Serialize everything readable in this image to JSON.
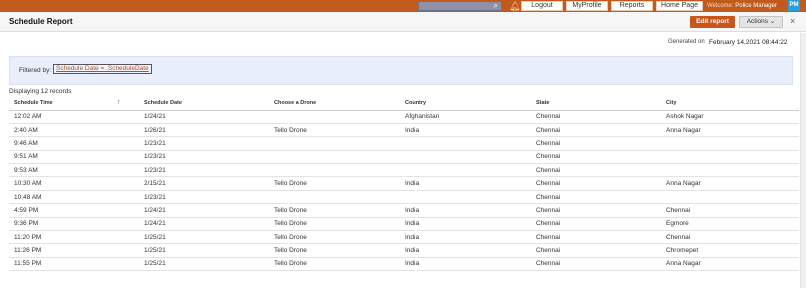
{
  "topbar": {
    "search_placeholder": "",
    "nav": [
      "Logout",
      "MyProfile",
      "Reports",
      "Home Page"
    ],
    "welcome_label": "Welcome:",
    "user_name": "Police Manager",
    "avatar_initials": "PM",
    "accent_color": "#c15a1b"
  },
  "header": {
    "title": "Schedule Report",
    "edit_label": "Edit report",
    "actions_label": "Actions",
    "close_symbol": "×"
  },
  "report": {
    "generated_label": "Generated on",
    "generated_value": "February 14,2021 08:44:22",
    "filter_label": "Filtered by:",
    "filter_value": "Schedule Date = .ScheduleDate",
    "displaying": "Displaying 12 records"
  },
  "table": {
    "columns": [
      "Schedule Time",
      "Schedule Date",
      "Choose a Drone",
      "Country",
      "State",
      "City"
    ],
    "rows": [
      [
        "12:02 AM",
        "1/24/21",
        "",
        "Afghanistan",
        "Chennai",
        "Ashok Nagar"
      ],
      [
        "2:40 AM",
        "1/26/21",
        "Tello Drone",
        "India",
        "Chennai",
        "Anna Nagar"
      ],
      [
        "9:46 AM",
        "1/23/21",
        "",
        "",
        "Chennai",
        ""
      ],
      [
        "9:51 AM",
        "1/23/21",
        "",
        "",
        "Chennai",
        ""
      ],
      [
        "9:53 AM",
        "1/23/21",
        "",
        "",
        "Chennai",
        ""
      ],
      [
        "10:30 AM",
        "2/15/21",
        "Tello Drone",
        "India",
        "Chennai",
        "Anna Nagar"
      ],
      [
        "10:48 AM",
        "1/23/21",
        "",
        "",
        "Chennai",
        ""
      ],
      [
        "4:59 PM",
        "1/24/21",
        "Tello Drone",
        "India",
        "Chennai",
        "Chennai"
      ],
      [
        "9:36 PM",
        "1/24/21",
        "Tello Drone",
        "India",
        "Chennai",
        "Egmore"
      ],
      [
        "11:20 PM",
        "1/25/21",
        "Tello Drone",
        "India",
        "Chennai",
        "Chennai"
      ],
      [
        "11:26 PM",
        "1/25/21",
        "Tello Drone",
        "India",
        "Chennai",
        "Chromepet"
      ],
      [
        "11:55 PM",
        "1/25/21",
        "Tello Drone",
        "India",
        "Chennai",
        "Anna Nagar"
      ]
    ]
  }
}
